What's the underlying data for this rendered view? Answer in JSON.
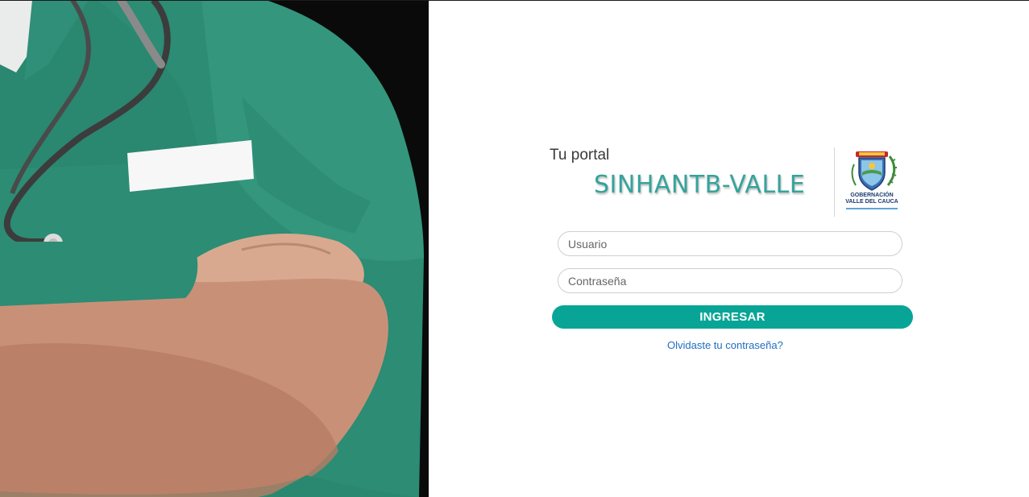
{
  "hero": {
    "image_description": "doctor-in-green-scrubs-with-stethoscope-arms-crossed"
  },
  "login": {
    "tagline": "Tu portal",
    "app_name": "SINHANTB-VALLE",
    "username_placeholder": "Usuario",
    "password_placeholder": "Contraseña",
    "submit_label": "INGRESAR",
    "forgot_link": "Olvidaste tu contraseña?"
  },
  "logo": {
    "line1": "GOBERNACIÓN",
    "line2": "VALLE DEL CAUCA"
  },
  "colors": {
    "accent": "#08a597",
    "title": "#35a39c",
    "link": "#1e6fbf",
    "scrubs": "#2f8f78"
  }
}
